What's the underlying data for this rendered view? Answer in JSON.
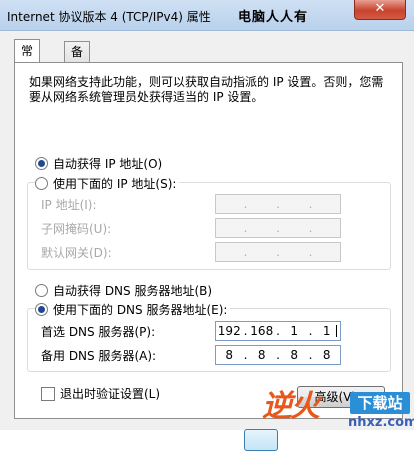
{
  "window": {
    "title": "Internet 协议版本 4 (TCP/IPv4) 属性",
    "watermark_top": "电脑人人有",
    "close_glyph": "✕"
  },
  "tabs": [
    {
      "label": "常规",
      "active": true
    },
    {
      "label": "备用配置",
      "active": false
    }
  ],
  "description": "如果网络支持此功能，则可以获取自动指派的 IP 设置。否则，您需要从网络系统管理员处获得适当的 IP 设置。",
  "ip_section": {
    "auto_label": "自动获得 IP 地址(O)",
    "auto_checked": true,
    "manual_label": "使用下面的 IP 地址(S):",
    "manual_checked": false,
    "fields": [
      {
        "label": "IP 地址(I):",
        "value": [
          "",
          "",
          "",
          ""
        ]
      },
      {
        "label": "子网掩码(U):",
        "value": [
          "",
          "",
          "",
          ""
        ]
      },
      {
        "label": "默认网关(D):",
        "value": [
          "",
          "",
          "",
          ""
        ]
      }
    ]
  },
  "dns_section": {
    "auto_label": "自动获得 DNS 服务器地址(B)",
    "auto_checked": false,
    "manual_label": "使用下面的 DNS 服务器地址(E):",
    "manual_checked": true,
    "preferred": {
      "label": "首选 DNS 服务器(P):",
      "value": [
        "192",
        "168",
        "1",
        "1"
      ]
    },
    "alternate": {
      "label": "备用 DNS 服务器(A):",
      "value": [
        "8",
        "8",
        "8",
        "8"
      ]
    }
  },
  "validate_on_exit": {
    "label": "退出时验证设置(L)",
    "checked": false
  },
  "advanced_button": "高级(V)...",
  "logo": {
    "main": "逆火",
    "badge": "下载站",
    "url": "nhxz.com"
  }
}
